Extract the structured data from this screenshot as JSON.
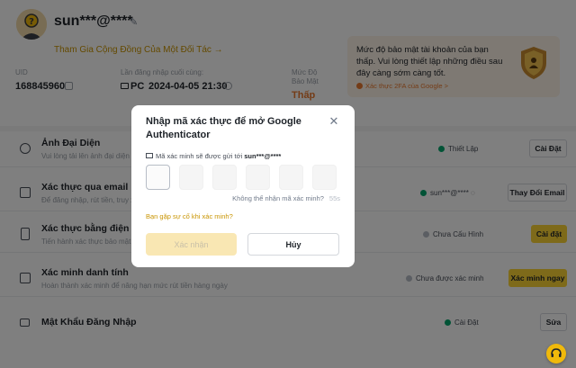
{
  "profile": {
    "username": "sun***@****",
    "community_link": "Tham Gia Cộng Đồng Của Một Đối Tác →",
    "uid_label": "UID",
    "uid_value": "168845960",
    "last_login_label": "Lần đăng nhập cuối cùng:",
    "last_login_device": "PC",
    "last_login_time": "2024-04-05 21:30",
    "security_label": "Mức Độ Bảo Mật",
    "security_value": "Thấp"
  },
  "warning": {
    "text": "Mức độ bảo mật tài khoản của bạn thấp. Vui lòng thiết lập những điều sau đây càng sớm càng tốt.",
    "link": "Xác thực 2FA của Google >"
  },
  "rows": [
    {
      "title": "Ảnh Đại Diện",
      "desc": "Vui lòng tải lên ảnh đại diện hợp lệ",
      "status": "Thiết Lập",
      "button": "Cài Đặt"
    },
    {
      "title": "Xác thực qua email",
      "desc": "Để đăng nhập, rút tiền, truy xuất",
      "status": "sun***@****",
      "button": "Thay Đổi Email"
    },
    {
      "title": "Xác thực bằng điện thoại di động",
      "desc": "Tiến hành xác thực bảo mật khi",
      "status": "Chưa Cấu Hình",
      "button": "Cài đặt"
    },
    {
      "title": "Xác minh danh tính",
      "desc": "Hoàn thành xác minh để nâng hạn mức rút tiền hàng ngày",
      "status": "Chưa được xác minh",
      "button": "Xác minh ngay"
    },
    {
      "title": "Mật Khẩu Đăng Nhập",
      "desc": "",
      "status": "Cài Đặt",
      "button": "Sửa"
    }
  ],
  "modal": {
    "title": "Nhập mã xác thực để mở Google Authenticator",
    "sent_prefix": "Mã xác minh sẽ được gửi tới",
    "sent_to": "sun***@****",
    "code_digits": [
      "",
      "",
      "",
      "",
      "",
      ""
    ],
    "resend_text": "Không thể nhận mã xác minh?",
    "resend_timer": "55s",
    "help_link": "Bạn gặp sự cố khi xác minh?",
    "confirm_label": "Xác nhận",
    "cancel_label": "Hủy"
  },
  "colors": {
    "accent": "#fcd535",
    "link": "#c99400",
    "warning": "#e8792f",
    "success": "#03a66d"
  }
}
